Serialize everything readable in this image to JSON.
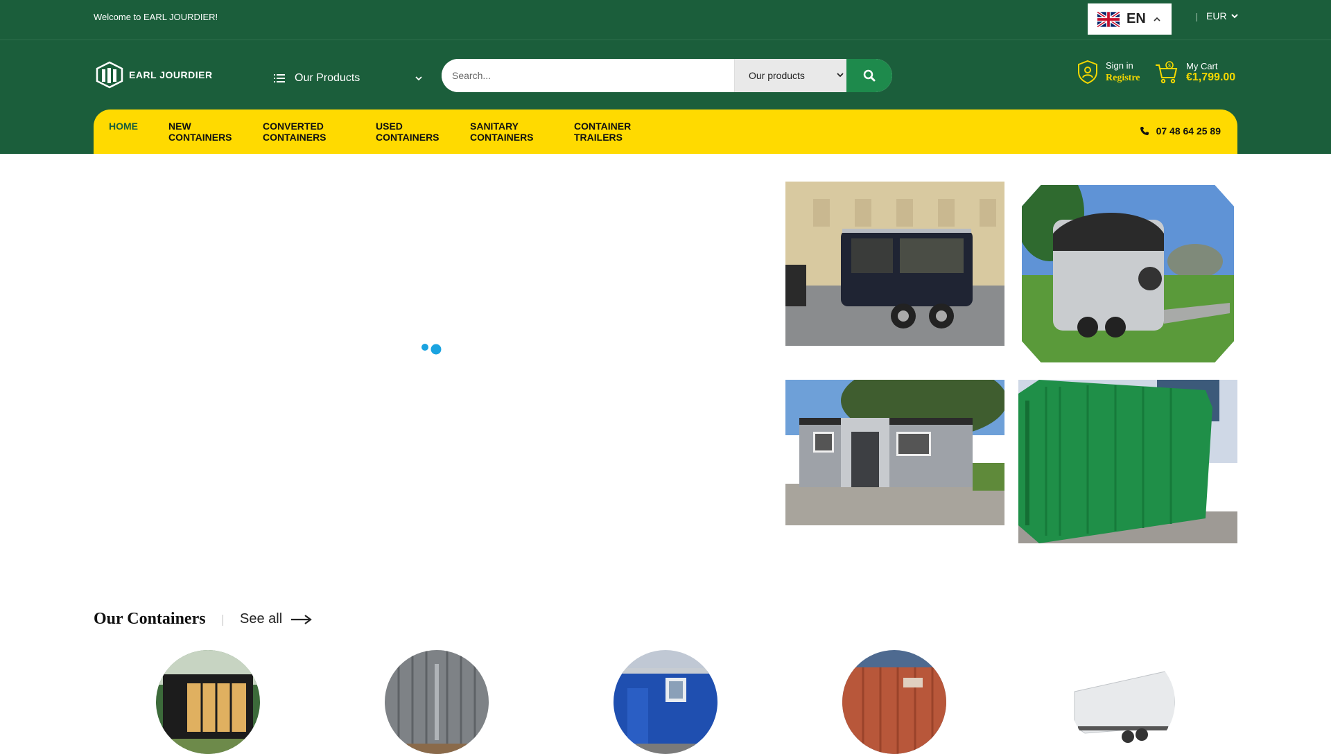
{
  "topbar": {
    "welcome": "Welcome to EARL JOURDIER!",
    "language": {
      "code": "EN",
      "flag": "uk-flag-icon"
    },
    "currency": "EUR"
  },
  "header": {
    "logo_text": "EARL JOURDIER",
    "products_dropdown": "Our Products",
    "search": {
      "placeholder": "Search...",
      "category": "Our products"
    },
    "account": {
      "line1": "Sign in",
      "line2": "Registre"
    },
    "cart": {
      "label": "My Cart",
      "total": "€1,799.00"
    }
  },
  "nav": {
    "items": [
      {
        "label": "HOME",
        "line2": ""
      },
      {
        "label": "NEW",
        "line2": "CONTAINERS"
      },
      {
        "label": "CONVERTED",
        "line2": "CONTAINERS"
      },
      {
        "label": "USED",
        "line2": "CONTAINERS"
      },
      {
        "label": "SANITARY",
        "line2": "CONTAINERS"
      },
      {
        "label": "CONTAINER",
        "line2": "TRAILERS"
      }
    ],
    "phone": "07 48 64 25 89"
  },
  "containers_section": {
    "title": "Our Containers",
    "see_all": "See all"
  },
  "colors": {
    "brand_green": "#1b5e3b",
    "accent_yellow": "#ffda00",
    "button_green": "#1e8a4c",
    "loader_blue": "#1aa3e0"
  }
}
